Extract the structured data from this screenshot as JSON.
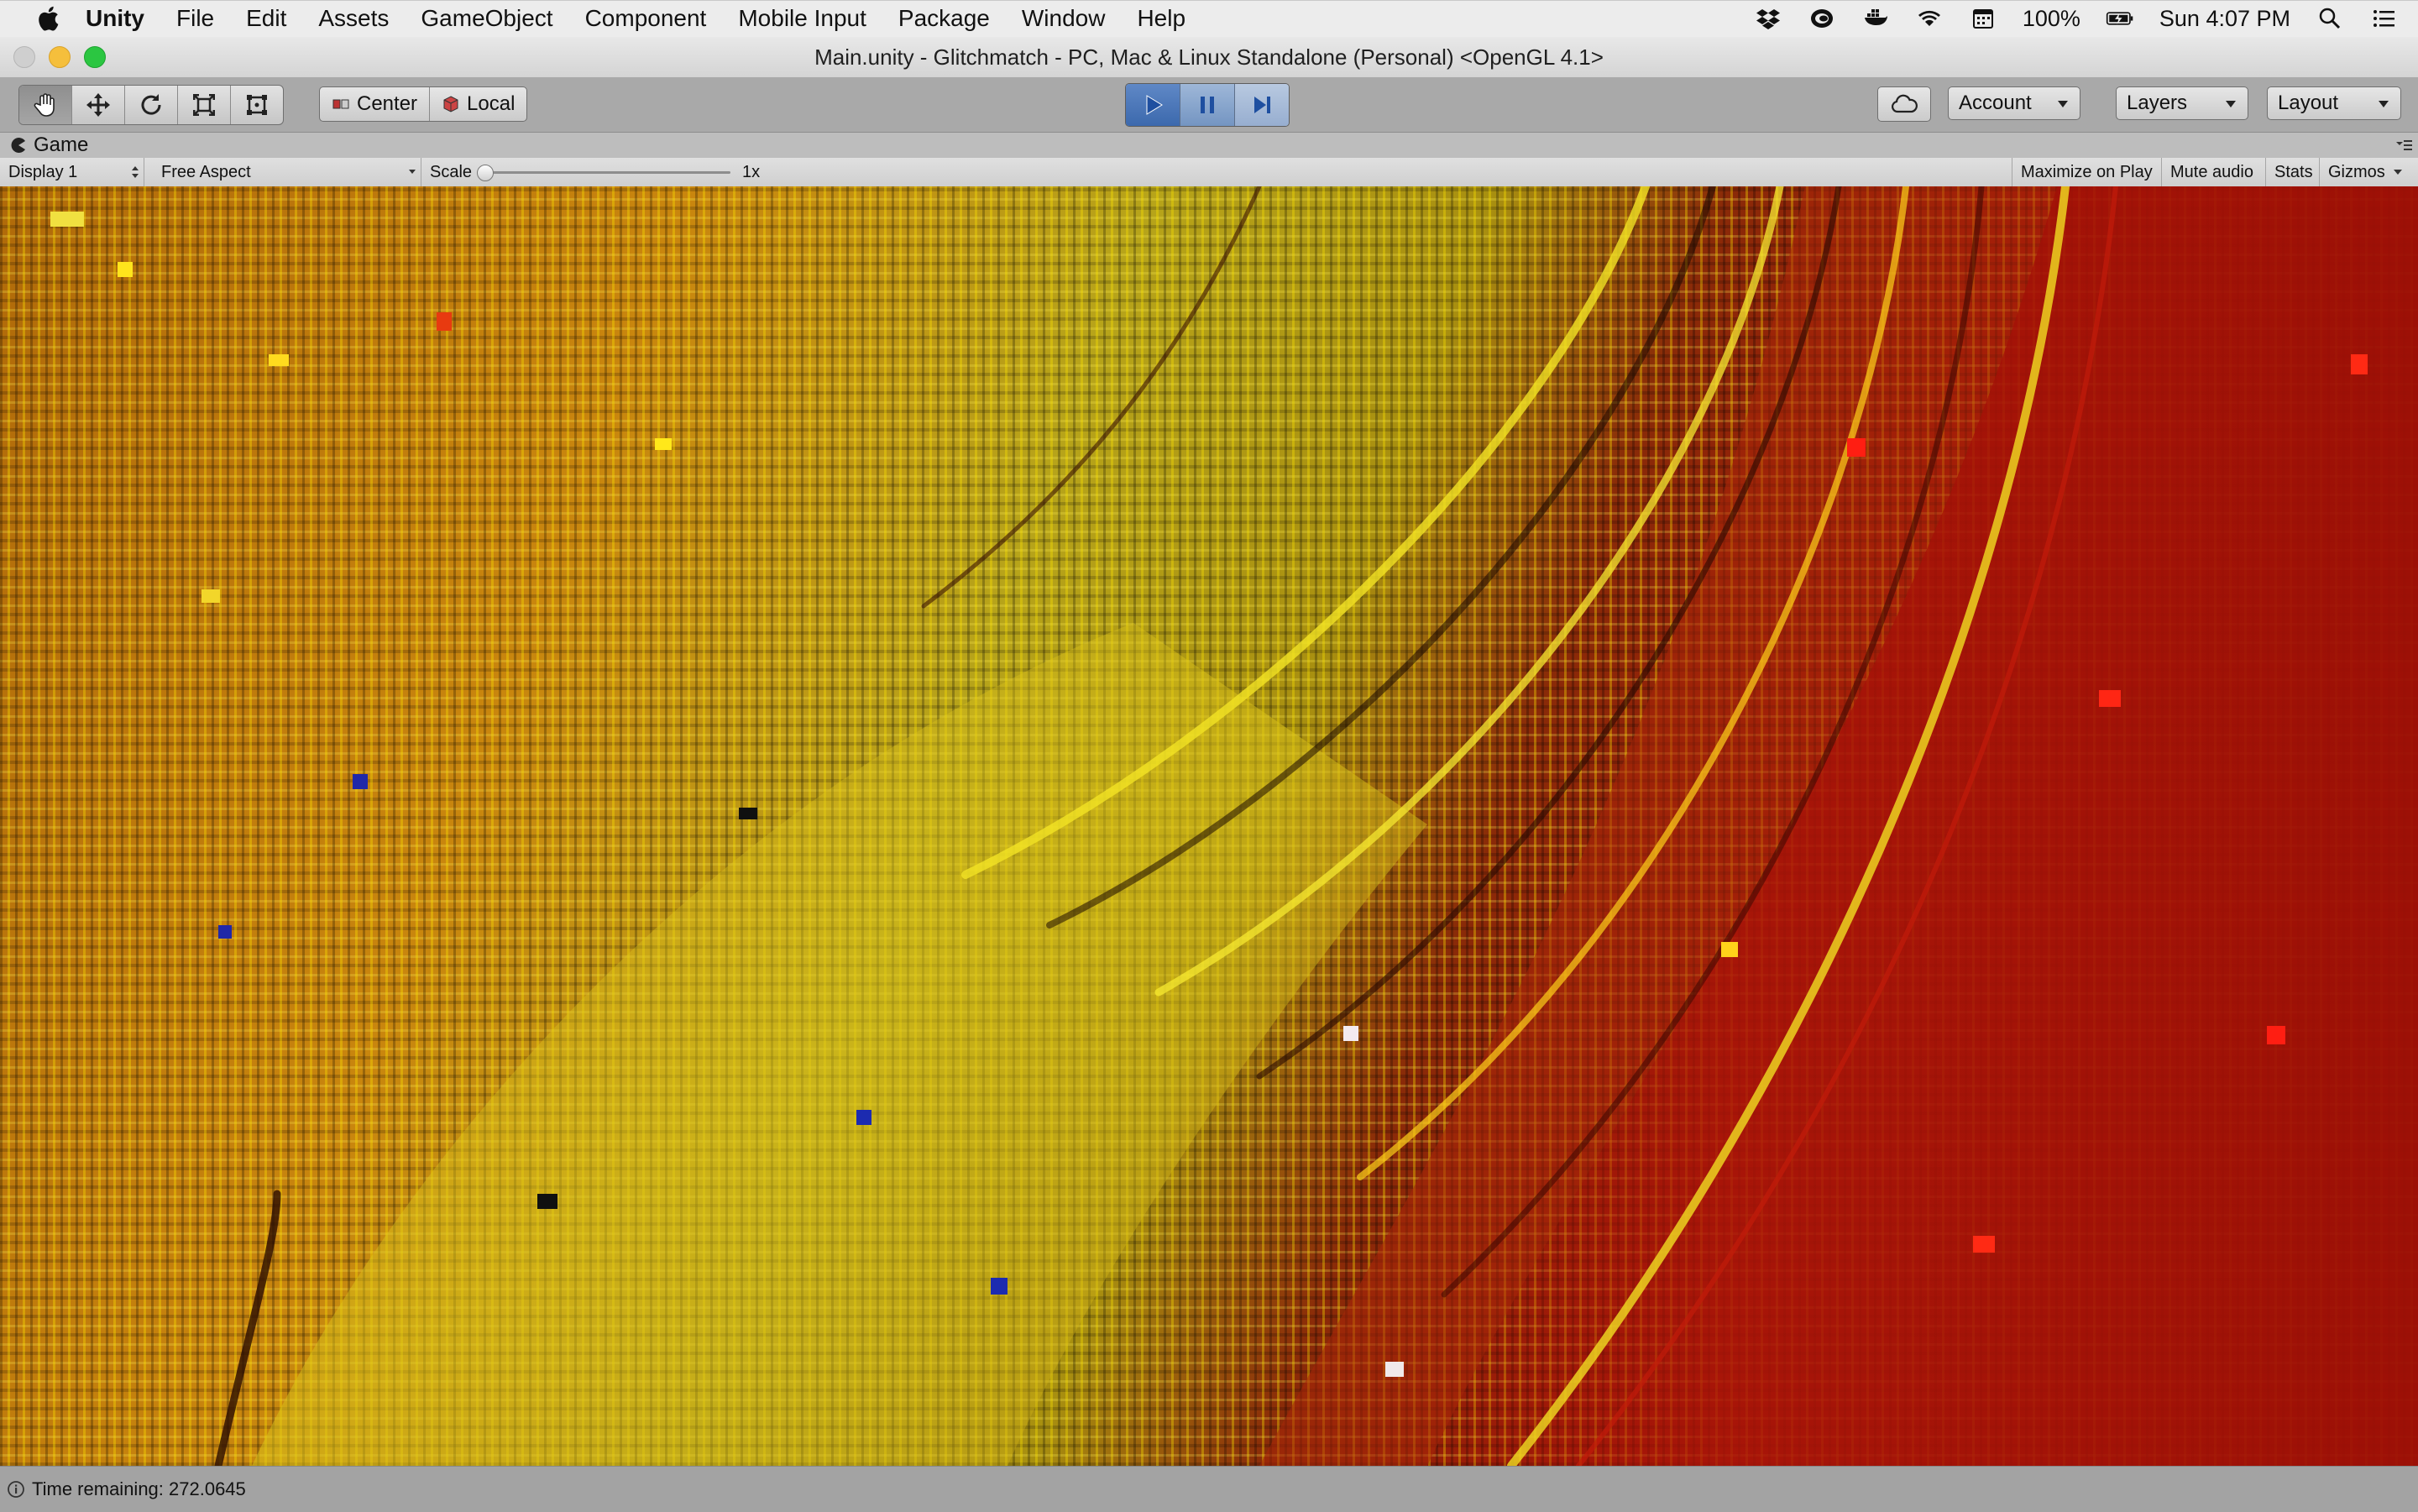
{
  "menubar": {
    "app_name": "Unity",
    "items": [
      "File",
      "Edit",
      "Assets",
      "GameObject",
      "Component",
      "Mobile Input",
      "Package",
      "Window",
      "Help"
    ],
    "battery": "100%",
    "clock": "Sun 4:07 PM"
  },
  "window": {
    "title": "Main.unity - Glitchmatch - PC, Mac & Linux Standalone (Personal) <OpenGL 4.1>"
  },
  "toolbar": {
    "tools": [
      "hand-icon",
      "move-icon",
      "rotate-icon",
      "scale-icon",
      "rect-tool-icon"
    ],
    "pivot_label": "Center",
    "space_label": "Local",
    "account_label": "Account",
    "layers_label": "Layers",
    "layout_label": "Layout",
    "play_state": "playing"
  },
  "game_tab": {
    "label": "Game"
  },
  "game_bar": {
    "display": "Display 1",
    "aspect": "Free Aspect",
    "scale_label": "Scale",
    "scale_value": "1x",
    "maximize": "Maximize on Play",
    "mute": "Mute audio",
    "stats": "Stats",
    "gizmos": "Gizmos"
  },
  "statusbar": {
    "message": "Time remaining: 272.0645"
  },
  "colors": {
    "play_active": "#3c69ad",
    "glitch_orange": "#c9860e",
    "glitch_red": "#a11408",
    "glitch_yellow": "#f2e21a"
  }
}
